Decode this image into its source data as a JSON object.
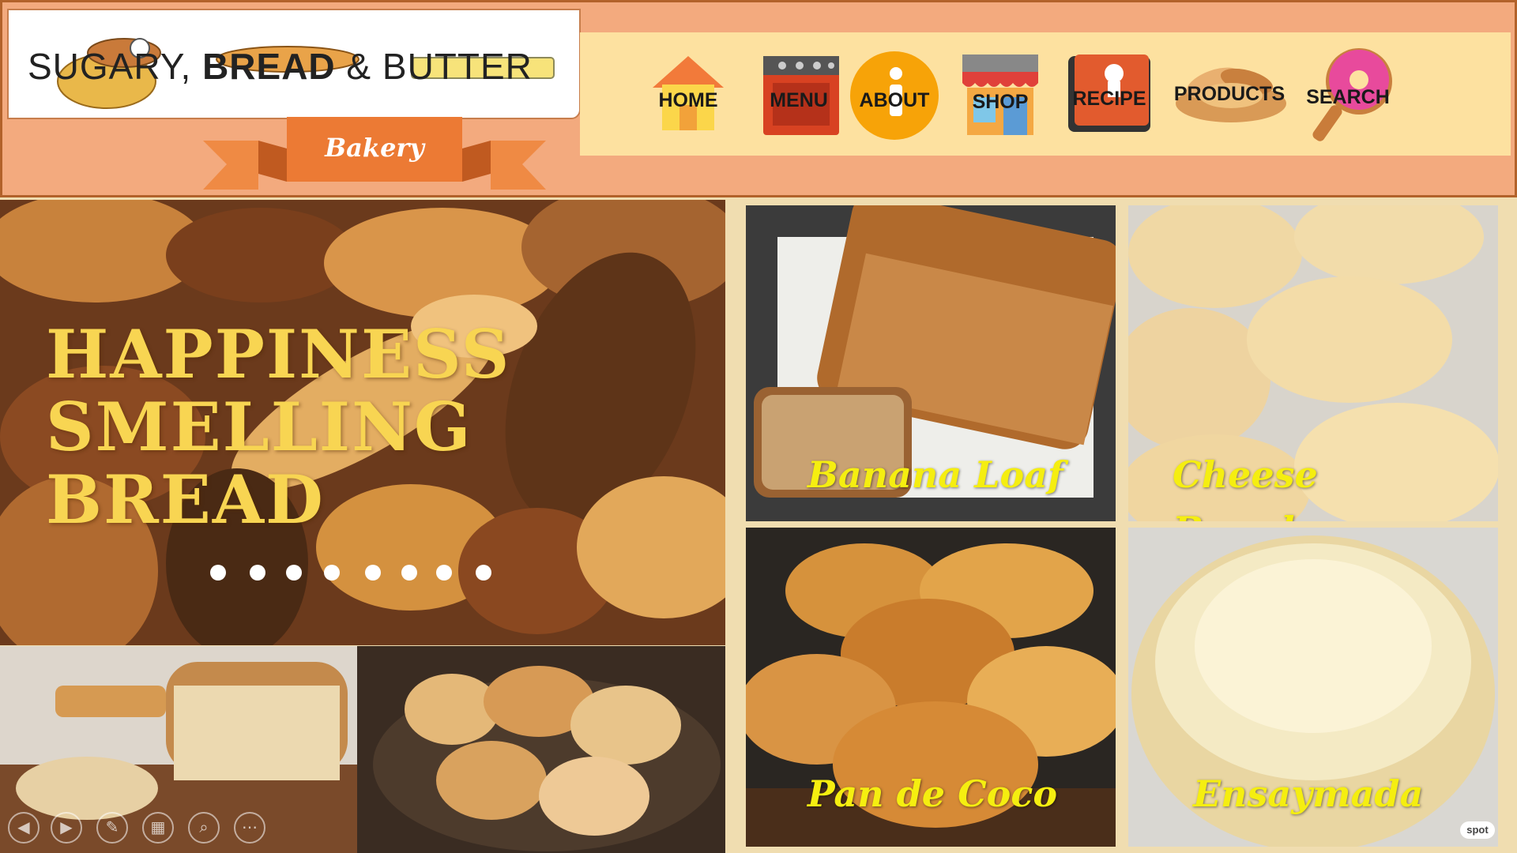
{
  "brand": {
    "name_part1": "SUGARY, ",
    "name_part2": "BREAD",
    "name_part3": " & BUTTER",
    "tagline": "Bakery"
  },
  "nav": [
    {
      "label": "HOME",
      "icon": "house-icon"
    },
    {
      "label": "MENU",
      "icon": "oven-icon"
    },
    {
      "label": "ABOUT",
      "icon": "info-icon"
    },
    {
      "label": "SHOP",
      "icon": "storefront-icon"
    },
    {
      "label": "RECIPE",
      "icon": "recipe-book-icon"
    },
    {
      "label": "PRODUCTS",
      "icon": "bread-basket-icon"
    },
    {
      "label": "SEARCH",
      "icon": "donut-icon"
    }
  ],
  "hero": {
    "line1": "HAPPINESS",
    "line2": "SMELLING",
    "line3": "BREAD",
    "dots_count": 8
  },
  "products": [
    {
      "label": "Banana Loaf"
    },
    {
      "label_line1": "Cheese",
      "label_line2": "Bread"
    },
    {
      "label": "Pan de Coco"
    },
    {
      "label": "Ensaymada"
    }
  ],
  "controls": [
    {
      "icon": "previous-icon"
    },
    {
      "icon": "next-icon"
    },
    {
      "icon": "pen-icon"
    },
    {
      "icon": "slides-icon"
    },
    {
      "icon": "zoom-icon"
    },
    {
      "icon": "more-icon"
    }
  ],
  "watermark": "spot",
  "colors": {
    "header_bg": "#f3aa7e",
    "nav_bg": "#fde1a0",
    "page_bg": "#f0ddb0",
    "hero_text": "#f8d552",
    "product_label": "#f5ee10"
  }
}
